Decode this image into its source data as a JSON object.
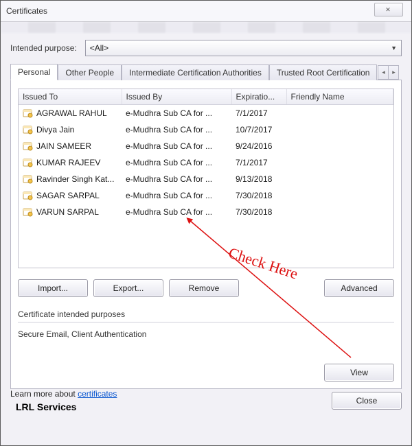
{
  "window": {
    "title": "Certificates"
  },
  "purpose": {
    "label": "Intended purpose:",
    "value": "<All>"
  },
  "tabs": [
    {
      "label": "Personal",
      "active": true
    },
    {
      "label": "Other People",
      "active": false
    },
    {
      "label": "Intermediate Certification Authorities",
      "active": false
    },
    {
      "label": "Trusted Root Certification",
      "active": false
    }
  ],
  "columns": {
    "issued_to": "Issued To",
    "issued_by": "Issued By",
    "expiration": "Expiratio...",
    "friendly": "Friendly Name"
  },
  "rows": [
    {
      "issued_to": "AGRAWAL RAHUL",
      "issued_by": "e-Mudhra Sub CA for ...",
      "expiration": "7/1/2017",
      "friendly": "<None>"
    },
    {
      "issued_to": "Divya Jain",
      "issued_by": "e-Mudhra Sub CA for ...",
      "expiration": "10/7/2017",
      "friendly": "<None>"
    },
    {
      "issued_to": "JAIN SAMEER",
      "issued_by": "e-Mudhra Sub CA for ...",
      "expiration": "9/24/2016",
      "friendly": "<None>"
    },
    {
      "issued_to": "KUMAR RAJEEV",
      "issued_by": "e-Mudhra Sub CA for ...",
      "expiration": "7/1/2017",
      "friendly": "<None>"
    },
    {
      "issued_to": "Ravinder Singh Kat...",
      "issued_by": "e-Mudhra Sub CA for ...",
      "expiration": "9/13/2018",
      "friendly": "<None>"
    },
    {
      "issued_to": "SAGAR SARPAL",
      "issued_by": "e-Mudhra Sub CA for ...",
      "expiration": "7/30/2018",
      "friendly": "<None>"
    },
    {
      "issued_to": "VARUN SARPAL",
      "issued_by": "e-Mudhra Sub CA for ...",
      "expiration": "7/30/2018",
      "friendly": "<None>"
    }
  ],
  "buttons": {
    "import": "Import...",
    "export": "Export...",
    "remove": "Remove",
    "advanced": "Advanced",
    "view": "View",
    "close": "Close"
  },
  "section": {
    "title": "Certificate intended purposes",
    "purposes": "Secure Email, Client Authentication"
  },
  "learn": {
    "prefix": "Learn more about ",
    "link": "certificates"
  },
  "brand": "LRL Services",
  "annotation": "Check Here"
}
